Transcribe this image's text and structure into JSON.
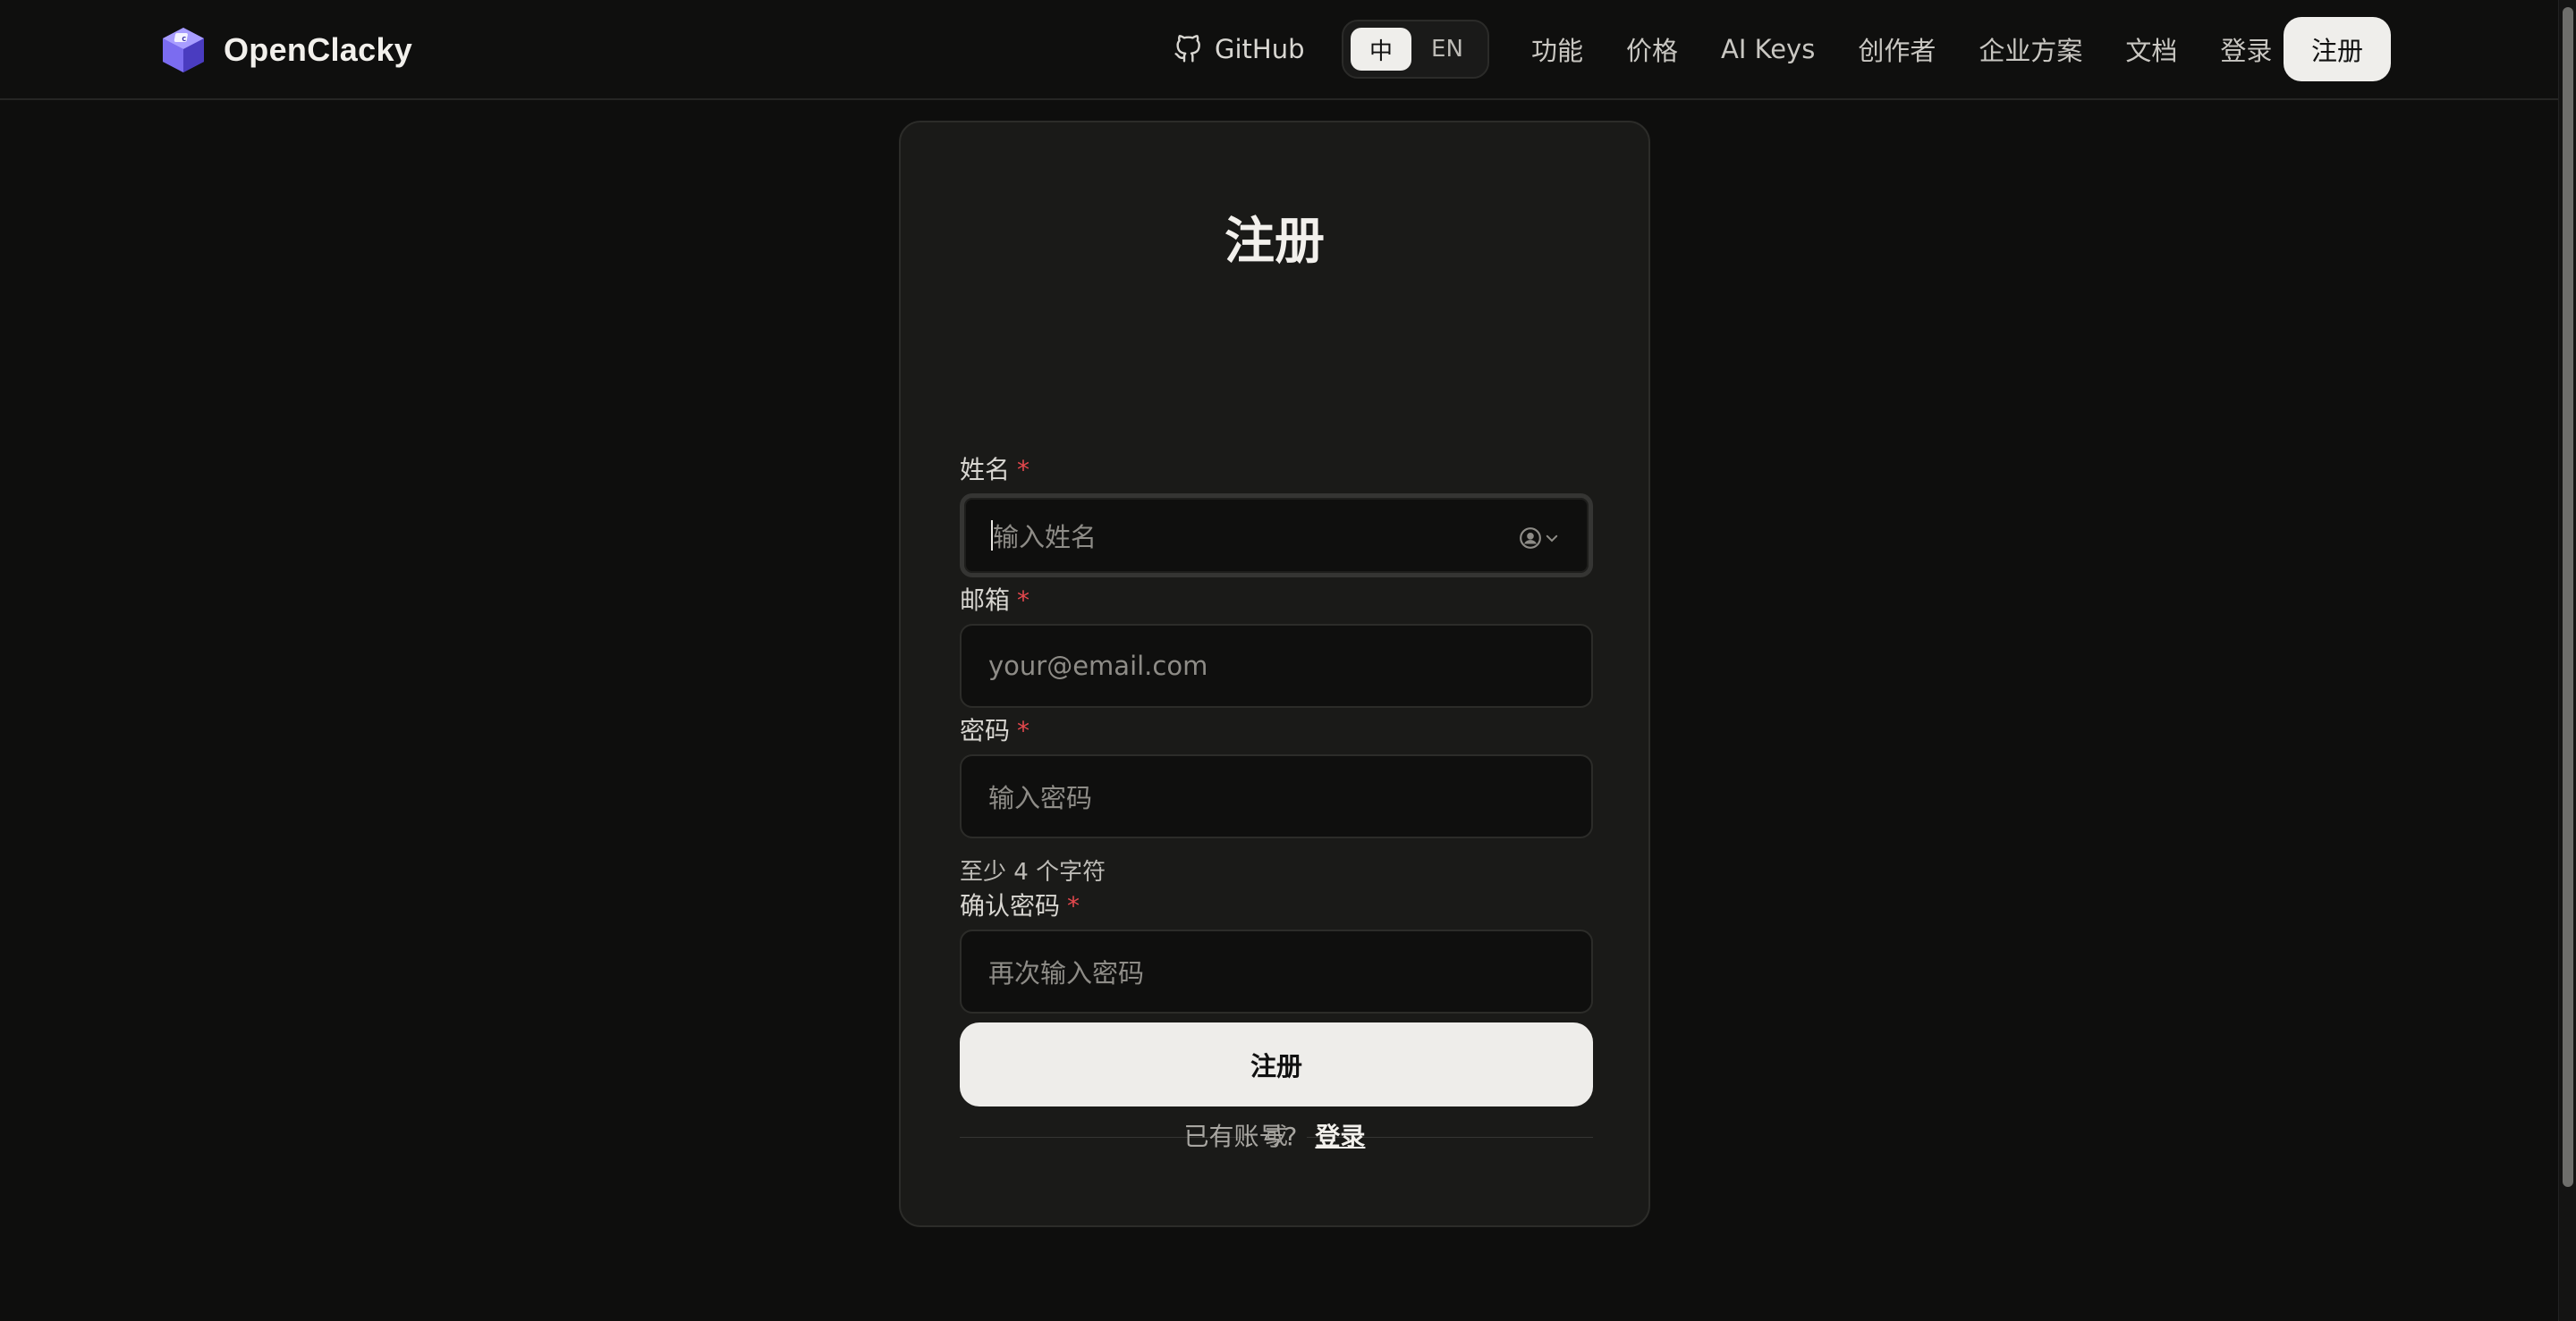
{
  "header": {
    "brand": "OpenClacky",
    "github_label": "GitHub",
    "lang": {
      "zh": "中",
      "en": "EN",
      "active": "zh"
    },
    "nav": [
      "功能",
      "价格",
      "AI Keys",
      "创作者",
      "企业方案",
      "文档",
      "登录"
    ],
    "signup_label": "注册"
  },
  "form": {
    "title": "注册",
    "required_mark": "*",
    "name": {
      "label": "姓名",
      "placeholder": "输入姓名"
    },
    "email": {
      "label": "邮箱",
      "placeholder": "your@email.com"
    },
    "password": {
      "label": "密码",
      "placeholder": "输入密码",
      "hint": "至少 4 个字符"
    },
    "confirm": {
      "label": "确认密码",
      "placeholder": "再次输入密码"
    },
    "submit_label": "注册",
    "or_label": "或",
    "have_account": "已有账号?",
    "login_label": "登录"
  },
  "colors": {
    "background": "#0e0e0d",
    "card": "#1a1a18",
    "accent_button": "#eeedea",
    "required": "#e5484d",
    "logo_purple": "#7b6cf0"
  },
  "icons": [
    "logo-cube-icon",
    "github-icon",
    "autofill-contact-icon",
    "chevron-down-icon"
  ]
}
